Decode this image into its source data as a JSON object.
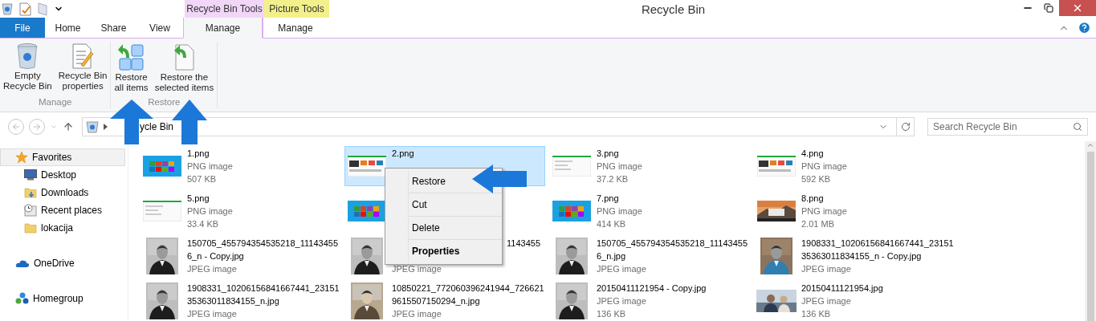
{
  "window": {
    "title": "Recycle Bin"
  },
  "contextual_tabs": [
    {
      "label": "Recycle Bin Tools",
      "color": "#f1d6f8"
    },
    {
      "label": "Picture Tools",
      "color": "#f3f08c"
    }
  ],
  "tabs": [
    {
      "label": "File",
      "kind": "file",
      "selected": false
    },
    {
      "label": "Home",
      "kind": "plain",
      "selected": false
    },
    {
      "label": "Share",
      "kind": "plain",
      "selected": false
    },
    {
      "label": "View",
      "kind": "plain",
      "selected": false
    },
    {
      "label": "Manage",
      "kind": "contextual",
      "selected": true
    },
    {
      "label": "Manage",
      "kind": "contextual",
      "selected": false
    }
  ],
  "ribbon": {
    "groups": [
      {
        "label": "Manage",
        "commands": [
          {
            "kind": "empty",
            "label_lines": [
              "Empty",
              "Recycle Bin"
            ]
          },
          {
            "kind": "properties",
            "label_lines": [
              "Recycle Bin",
              "properties"
            ]
          }
        ]
      },
      {
        "label": "Restore",
        "commands": [
          {
            "kind": "restore_all",
            "label_lines": [
              "Restore",
              "all items"
            ]
          },
          {
            "kind": "restore_selected",
            "label_lines": [
              "Restore the",
              "selected items"
            ]
          }
        ]
      }
    ]
  },
  "address_bar": {
    "path": "ycle Bin"
  },
  "search": {
    "placeholder": "Search Recycle Bin"
  },
  "navigation": [
    {
      "kind": "favorites",
      "label": "Favorites",
      "selected": true,
      "children": [
        {
          "kind": "desktop",
          "label": "Desktop",
          "selected": false
        },
        {
          "kind": "downloads",
          "label": "Downloads",
          "selected": false
        },
        {
          "kind": "recent",
          "label": "Recent places",
          "selected": false
        },
        {
          "kind": "folder",
          "label": "lokacija",
          "selected": false
        }
      ]
    },
    {
      "kind": "onedrive",
      "label": "OneDrive",
      "selected": false
    },
    {
      "kind": "homegroup",
      "label": "Homegroup",
      "selected": false
    }
  ],
  "files": [
    {
      "name_lines": [
        "1.png"
      ],
      "type": "PNG image",
      "size": "507 KB",
      "selected": false
    },
    {
      "name_lines": [
        "2.png"
      ],
      "selected": true
    },
    {
      "name_lines": [
        "3.png"
      ],
      "type": "PNG image",
      "size": "37.2 KB",
      "selected": false
    },
    {
      "name_lines": [
        "4.png"
      ],
      "type": "PNG image",
      "size": "592 KB",
      "selected": false
    },
    {
      "name_lines": [
        "5.png"
      ],
      "type": "PNG image",
      "size": "33.4 KB",
      "selected": false
    },
    {
      "selected": false
    },
    {
      "name_lines": [
        "7.png"
      ],
      "type": "PNG image",
      "size": "414 KB",
      "selected": false
    },
    {
      "name_lines": [
        "8.png"
      ],
      "type": "PNG image",
      "size": "2.01 MB",
      "selected": false
    },
    {
      "name_lines": [
        "150705_455794354535218_11143455",
        "6_n - Copy.jpg"
      ],
      "type": "JPEG image",
      "selected": false
    },
    {
      "name_lines": [
        "1143455"
      ],
      "type": "JPEG image",
      "covered": true,
      "selected": false
    },
    {
      "name_lines": [
        "150705_455794354535218_11143455",
        "6_n.jpg"
      ],
      "type": "JPEG image",
      "selected": false
    },
    {
      "name_lines": [
        "1908331_10206156841667441_23151",
        "35363011834155_n - Copy.jpg"
      ],
      "type": "JPEG image",
      "selected": false
    },
    {
      "name_lines": [
        "1908331_10206156841667441_23151",
        "35363011834155_n.jpg"
      ],
      "type": "JPEG image",
      "selected": false
    },
    {
      "name_lines": [
        "10850221_772060396241944_726621",
        "9615507150294_n.jpg"
      ],
      "type": "JPEG image",
      "selected": false
    },
    {
      "name_lines": [
        "20150411121954 - Copy.jpg"
      ],
      "type": "JPEG image",
      "size": "136 KB",
      "selected": false
    },
    {
      "name_lines": [
        "20150411121954.jpg"
      ],
      "type": "JPEG image",
      "size": "136 KB",
      "selected": false
    }
  ],
  "context_menu": [
    {
      "label": "Restore",
      "default": false
    },
    {
      "label": "Cut",
      "default": false
    },
    {
      "label": "Delete",
      "default": false
    },
    {
      "label": "Properties",
      "default": true
    }
  ]
}
